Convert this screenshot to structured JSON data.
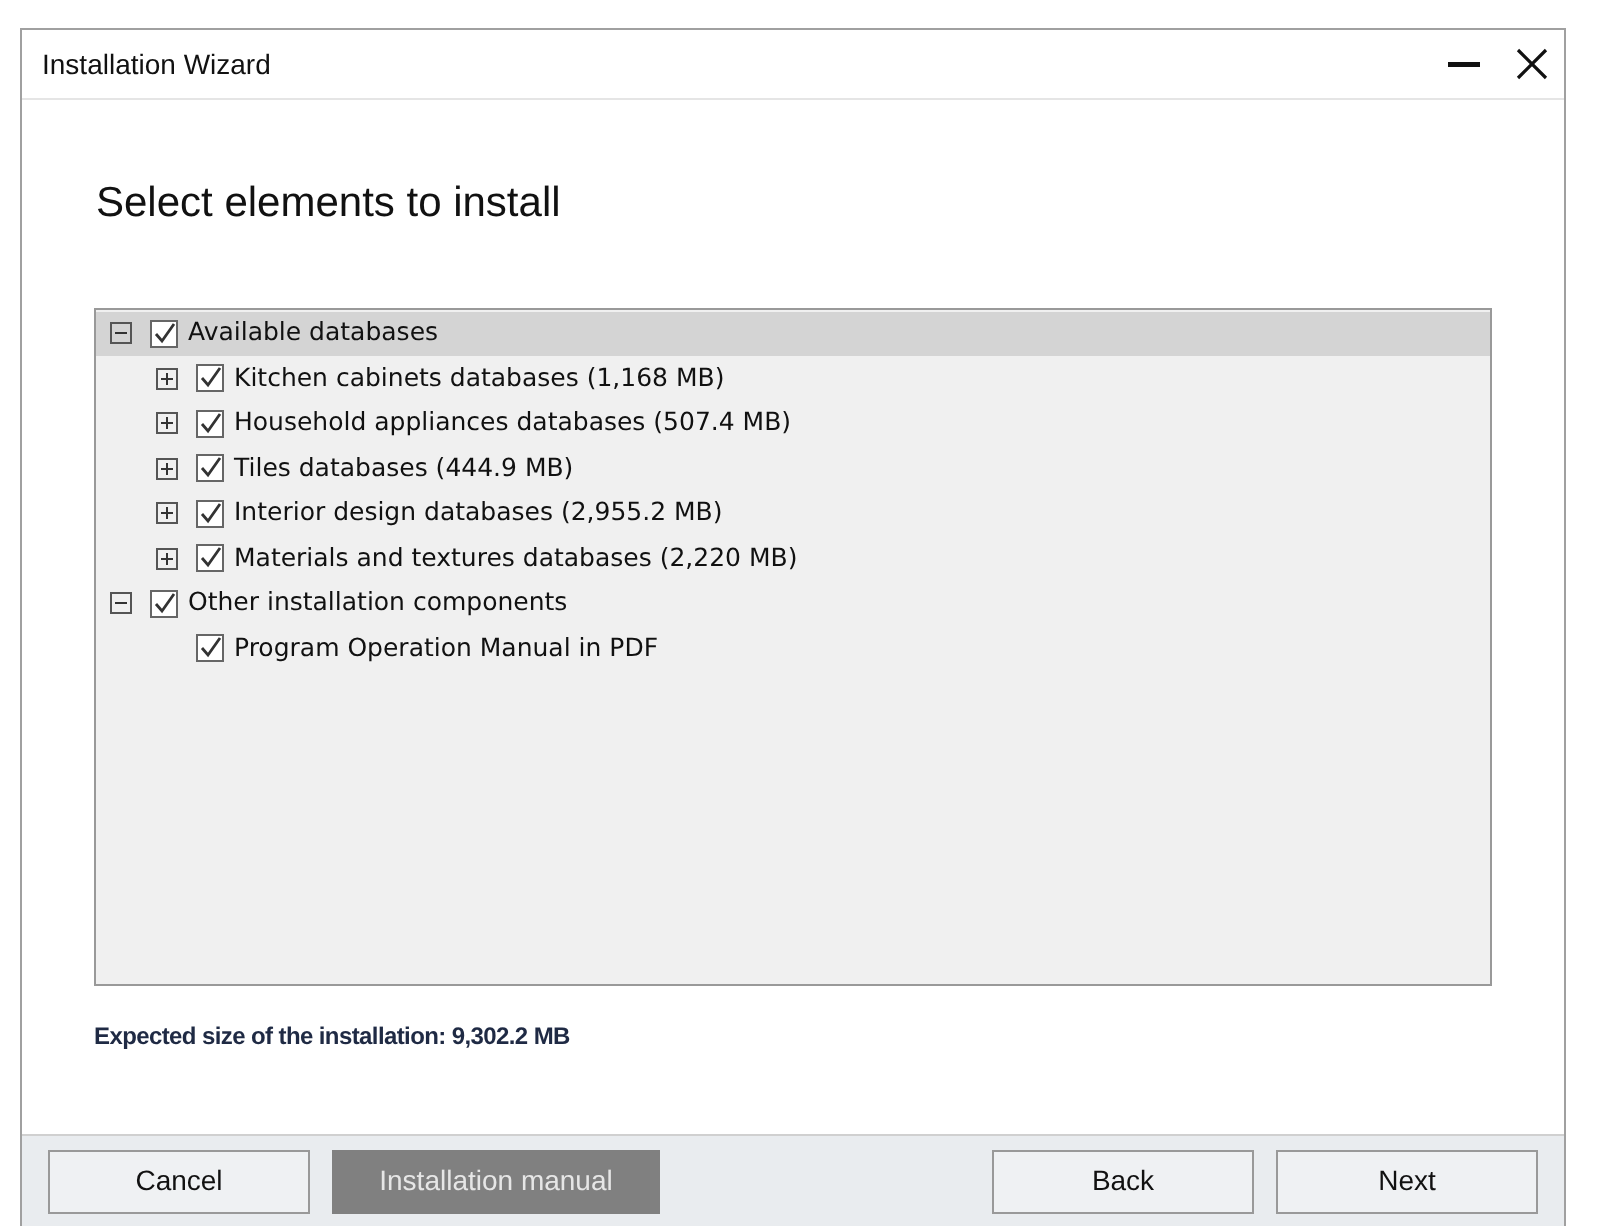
{
  "window": {
    "title": "Installation Wizard"
  },
  "heading": "Select elements to install",
  "tree": [
    {
      "label": "Available databases",
      "checked": true,
      "expanded": true,
      "selected": true,
      "children": [
        {
          "label": "Kitchen cabinets databases (1,168 MB)",
          "checked": true,
          "expanded": false,
          "selected": false
        },
        {
          "label": "Household appliances databases (507.4 MB)",
          "checked": true,
          "expanded": false,
          "selected": false
        },
        {
          "label": "Tiles databases (444.9 MB)",
          "checked": true,
          "expanded": false,
          "selected": false
        },
        {
          "label": "Interior design databases (2,955.2 MB)",
          "checked": true,
          "expanded": false,
          "selected": false
        },
        {
          "label": "Materials and textures databases (2,220 MB)",
          "checked": true,
          "expanded": false,
          "selected": false
        }
      ]
    },
    {
      "label": "Other installation components",
      "checked": true,
      "expanded": true,
      "selected": false,
      "children": [
        {
          "label": "Program Operation Manual in PDF",
          "checked": true,
          "selected": false
        }
      ]
    }
  ],
  "expected_size": "Expected size of the installation: 9,302.2 MB",
  "buttons": [
    {
      "label": "Cancel",
      "disabled": false
    },
    {
      "label": "Installation manual",
      "disabled": true
    },
    {
      "label": "Back",
      "disabled": false
    },
    {
      "label": "Next",
      "disabled": false
    }
  ]
}
